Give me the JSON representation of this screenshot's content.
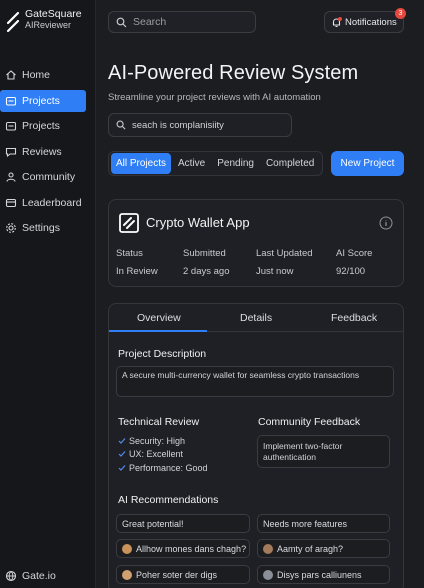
{
  "brand": {
    "name": "GateSquare",
    "sub": "AIReviewer"
  },
  "sidebar": {
    "items": [
      {
        "label": "Home",
        "icon": "home-icon"
      },
      {
        "label": "Projects",
        "icon": "folder-icon",
        "active": true
      },
      {
        "label": "Projects",
        "icon": "folder-icon"
      },
      {
        "label": "Reviews",
        "icon": "chat-icon"
      },
      {
        "label": "Community",
        "icon": "people-icon"
      },
      {
        "label": "Leaderboard",
        "icon": "trophy-icon"
      },
      {
        "label": "Settings",
        "icon": "gear-icon"
      }
    ],
    "footer": "Gate.io"
  },
  "header": {
    "search_placeholder": "Search",
    "notifications_label": "Notifications",
    "notifications_count": "3"
  },
  "page": {
    "title": "AI-Powered Review System",
    "subtitle": "Streamline your project reviews with AI automation",
    "search_value": "seach is complanisiity"
  },
  "filters": [
    "All Projects",
    "Active",
    "Pending",
    "Completed"
  ],
  "new_project_label": "New Project",
  "project": {
    "name": "Crypto Wallet App",
    "stats": [
      {
        "label": "Status",
        "value": "In Review"
      },
      {
        "label": "Submitted",
        "value": "2 days ago"
      },
      {
        "label": "Last Updated",
        "value": "Just now"
      },
      {
        "label": "AI Score",
        "value": "92/100"
      }
    ]
  },
  "detail": {
    "tabs": [
      "Overview",
      "Details",
      "Feedback"
    ],
    "description_title": "Project Description",
    "description": "A secure multi-currency wallet for seamless crypto transactions",
    "technical_title": "Technical Review",
    "checks": [
      "Security: High",
      "UX: Excellent",
      "Performance: Good"
    ],
    "community_title": "Community Feedback",
    "community_text": "Implement two-factor authentication",
    "recommendations_title": "AI Recommendations",
    "recommendations": [
      "Great potential!",
      "Needs more features",
      "Allhow mones dans chagh?",
      "Aamty of aragh?",
      "Poher soter der digs",
      "Disys pars calliunens"
    ]
  },
  "colors": {
    "accent": "#2f7ef5",
    "badge": "#e5483e"
  }
}
